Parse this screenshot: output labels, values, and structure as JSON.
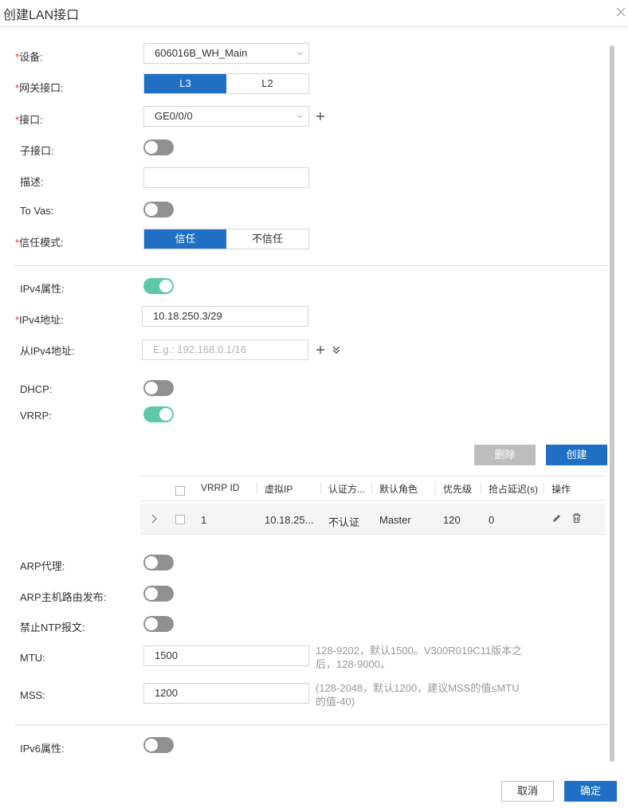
{
  "dialog": {
    "title": "创建LAN接口"
  },
  "form": {
    "device": {
      "label": "设备:",
      "value": "606016B_WH_Main"
    },
    "gateway_iface": {
      "label": "网关接口:",
      "options": [
        "L3",
        "L2"
      ],
      "selected": "L3"
    },
    "interface": {
      "label": "接口:",
      "value": "GE0/0/0"
    },
    "sub_interface": {
      "label": "子接口:",
      "on": false
    },
    "description": {
      "label": "描述:",
      "value": ""
    },
    "to_vas": {
      "label": "To Vas:",
      "on": false
    },
    "trust_mode": {
      "label": "信任模式:",
      "options": [
        "信任",
        "不信任"
      ],
      "selected": "信任"
    },
    "ipv4_props": {
      "label": "IPv4属性:",
      "on": true
    },
    "ipv4_addr": {
      "label": "IPv4地址:",
      "value": "10.18.250.3/29"
    },
    "secondary_ipv4": {
      "label": "从IPv4地址:",
      "placeholder": "E.g.: 192.168.0.1/16"
    },
    "dhcp": {
      "label": "DHCP:",
      "on": false
    },
    "vrrp": {
      "label": "VRRP:",
      "on": true
    },
    "arp_proxy": {
      "label": "ARP代理:",
      "on": false
    },
    "arp_host_route": {
      "label": "ARP主机路由发布:",
      "on": false
    },
    "ban_ntp": {
      "label": "禁止NTP报文:",
      "on": false
    },
    "mtu": {
      "label": "MTU:",
      "value": "1500",
      "hint_line1": "128-9202，默认1500。V300R019C11版本之",
      "hint_line2": "后，128-9000。"
    },
    "mss": {
      "label": "MSS:",
      "value": "1200",
      "hint_line1": "(128-2048，默认1200，建议MSS的值≤MTU",
      "hint_line2": "的值-40)"
    },
    "ipv6_props": {
      "label": "IPv6属性:",
      "on": false
    }
  },
  "vrrp_table": {
    "delete_label": "删除",
    "create_label": "创建",
    "headers": [
      "VRRP ID",
      "虚拟IP",
      "认证方...",
      "默认角色",
      "优先级",
      "抢占延迟(s)",
      "操作"
    ],
    "rows": [
      {
        "id": "1",
        "virtual_ip": "10.18.25...",
        "auth": "不认证",
        "role": "Master",
        "priority": "120",
        "preempt_delay": "0"
      }
    ]
  },
  "footer": {
    "cancel_label": "取消",
    "confirm_label": "确定"
  },
  "colors": {
    "primary": "#1f6fc5",
    "toggle_on": "#5cc8a8",
    "toggle_off": "#909090",
    "required": "#e0332c"
  }
}
